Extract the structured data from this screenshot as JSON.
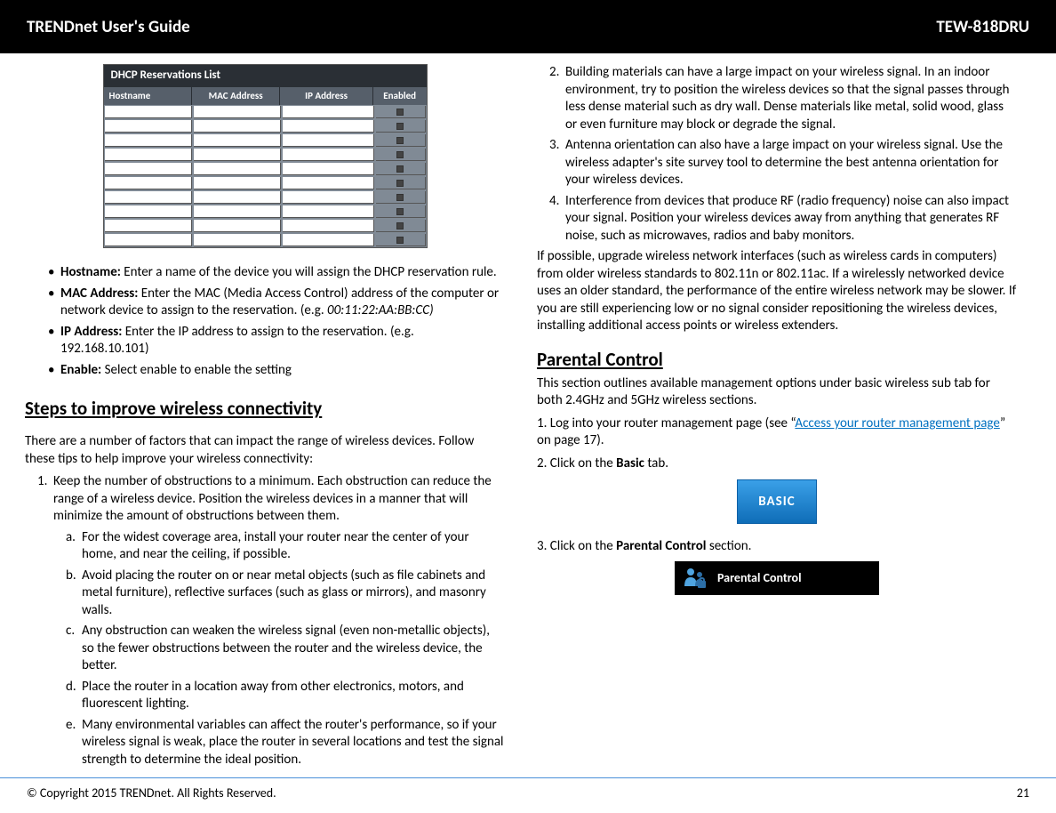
{
  "header": {
    "left": "TRENDnet User's Guide",
    "right": "TEW-818DRU"
  },
  "dhcp": {
    "title": "DHCP Reservations List",
    "cols": [
      "Hostname",
      "MAC Address",
      "IP Address",
      "Enabled"
    ]
  },
  "defs": {
    "hostname_label": "Hostname:",
    "hostname_text": " Enter a name of the device you will assign the DHCP reservation rule.",
    "mac_label": "MAC Address:",
    "mac_text": " Enter the MAC (Media Access Control) address of the computer or network device to assign to the reservation. (e.g. ",
    "mac_example": "00:11:22:AA:BB:CC)",
    "ip_label": "IP Address:",
    "ip_text": " Enter the IP address to assign to the reservation. (e.g. 192.168.10.101)",
    "enable_label": "Enable:",
    "enable_text": " Select enable to enable the setting"
  },
  "steps_heading": "Steps to improve wireless connectivity",
  "steps_intro": "There are a number of factors that can impact the range of wireless devices. Follow these tips to help improve your wireless connectivity:",
  "step1": "Keep the number of obstructions to a minimum. Each obstruction can reduce the range of a wireless device.  Position the wireless devices in a manner that will minimize the amount of obstructions between them.",
  "sub": {
    "a": "For the widest coverage area, install your router near the center of your home, and near the ceiling, if possible.",
    "b": "Avoid placing the router on or near metal objects (such as file cabinets and metal furniture), reflective surfaces (such as glass or mirrors), and masonry walls.",
    "c": "Any obstruction can weaken the wireless signal (even non-metallic objects), so the fewer obstructions between the router and the wireless device, the better.",
    "d": "Place the router in a location away from other electronics, motors, and fluorescent lighting.",
    "e": "Many environmental variables can affect the router's performance, so if your wireless signal is weak, place the router in several locations and test the signal strength to determine the ideal position."
  },
  "step2": "Building materials can have a large impact on your wireless signal. In an indoor environment, try to position the wireless devices so that the signal passes through less dense material such as dry wall.  Dense materials like metal, solid wood, glass or even furniture may block or degrade the signal.",
  "step3": "Antenna orientation can also have a large impact on your wireless signal. Use the wireless adapter's site survey tool to determine the best antenna orientation for your wireless devices.",
  "step4": "Interference from devices that produce RF (radio frequency) noise can also impact your signal. Position your wireless devices away from anything that generates RF noise, such as microwaves, radios and baby monitors.",
  "upgrade": "If possible, upgrade wireless network interfaces (such as wireless cards in computers) from older wireless standards to 802.11n or 802.11ac. If a wirelessly networked device uses an older standard, the performance of the entire wireless network may be slower. If you are still experiencing low or no signal consider repositioning the wireless devices, installing additional access points or wireless extenders.",
  "parental_heading": "Parental Control",
  "parental_intro": "This section outlines available management options under basic wireless sub tab for both 2.4GHz and 5GHz wireless sections.",
  "pc1a": "1. Log into your router management page (see “",
  "pc1_link": "Access your router management page",
  "pc1b": "” on page 17).",
  "pc2a": "2. Click on the ",
  "pc2b": "Basic",
  "pc2c": " tab.",
  "basic_label": "BASIC",
  "pc3a": "3.  Click on the ",
  "pc3b": "Parental Control",
  "pc3c": " section.",
  "pc_btn_label": "Parental Control",
  "footer": {
    "copyright": "© Copyright 2015 TRENDnet. All Rights Reserved.",
    "page": "21"
  }
}
